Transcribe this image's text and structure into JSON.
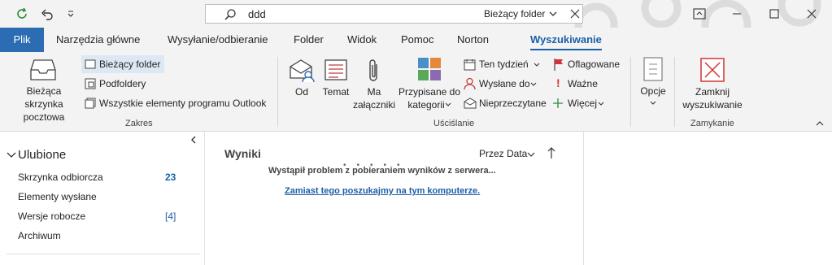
{
  "search": {
    "value": "ddd",
    "scope": "Bieżący folder"
  },
  "tabs": [
    "Plik",
    "Narzędzia główne",
    "Wysyłanie/odbieranie",
    "Folder",
    "Widok",
    "Pomoc",
    "Norton",
    "Wyszukiwanie"
  ],
  "active_tab": "Wyszukiwanie",
  "ribbon": {
    "zakres": {
      "big": "Bieżąca skrzynka\npocztowa",
      "current_folder": "Bieżący folder",
      "subfolders": "Podfoldery",
      "all_items": "Wszystkie elementy programu Outlook",
      "label": "Zakres"
    },
    "uscislanie": {
      "od": "Od",
      "temat": "Temat",
      "ma": "Ma",
      "zalaczniki": "załączniki",
      "przypisane": "Przypisane do",
      "kategorii": "kategorii",
      "ten_tydzien": "Ten tydzień",
      "wyslane_do": "Wysłane do",
      "nieprzeczytane": "Nieprzeczytane",
      "oflagowane": "Oflagowane",
      "wazne": "Ważne",
      "wiecej": "Więcej",
      "label": "Uściślanie"
    },
    "opcje": {
      "label": "Opcje"
    },
    "zamykanie": {
      "zamknij": "Zamknij",
      "wyszukiwanie": "wyszukiwanie",
      "label": "Zamykanie"
    }
  },
  "favorites": {
    "title": "Ulubione",
    "items": [
      {
        "label": "Skrzynka odbiorcza",
        "count": "23"
      },
      {
        "label": "Elementy wysłane",
        "count": ""
      },
      {
        "label": "Wersje robocze",
        "count": "[4]"
      },
      {
        "label": "Archiwum",
        "count": ""
      }
    ]
  },
  "results": {
    "title": "Wyniki",
    "sort": "Przez Data",
    "error": "Wystąpił problem z pobieraniem wyników z serwera...",
    "link": "Zamiast tego poszukajmy na tym komputerze."
  },
  "colors": {
    "accent": "#1b5fa8",
    "file_tab": "#2b6cb3",
    "close_icon": "#d13438",
    "flag": "#d13438"
  }
}
